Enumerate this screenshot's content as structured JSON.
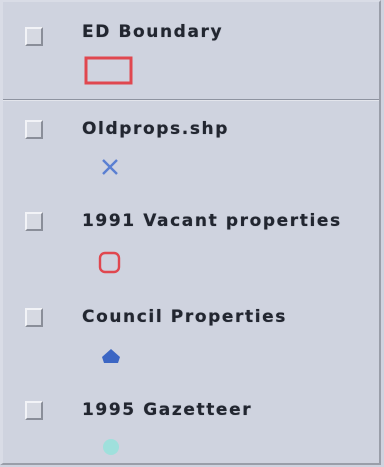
{
  "layers": [
    {
      "label": "ED Boundary",
      "checked": false,
      "symbol": "rectangle-outline",
      "symbol_color": "#e0474f"
    },
    {
      "label": "Oldprops.shp",
      "checked": false,
      "symbol": "cross",
      "symbol_color": "#5a7fd2"
    },
    {
      "label": "1991 Vacant properties",
      "checked": false,
      "symbol": "rounded-square-outline",
      "symbol_color": "#e0474f"
    },
    {
      "label": "Council Properties",
      "checked": false,
      "symbol": "pentagon-arrow",
      "symbol_color": "#3c66c4"
    },
    {
      "label": "1995 Gazetteer",
      "checked": false,
      "symbol": "circle-dot",
      "symbol_color": "#9fe0dc"
    }
  ]
}
